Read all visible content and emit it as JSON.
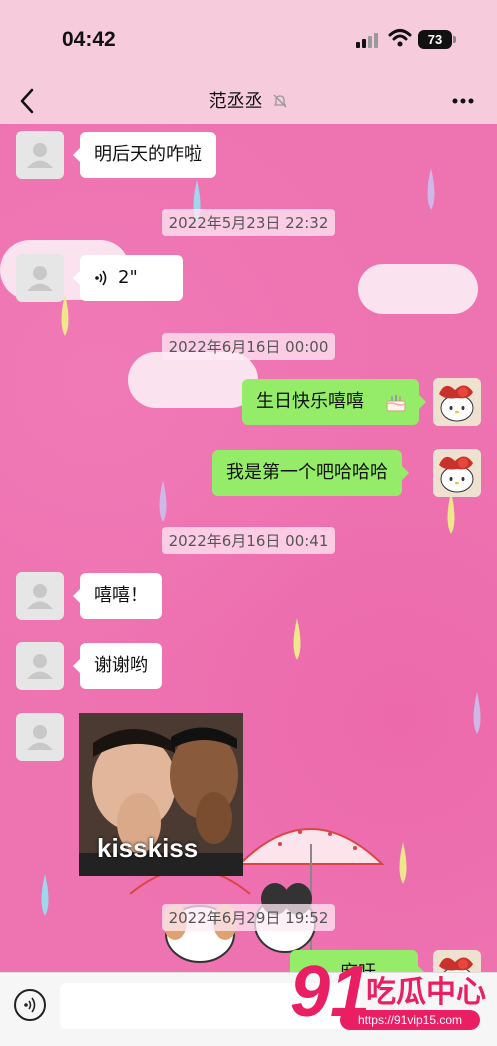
{
  "status": {
    "time": "04:42",
    "battery": "73"
  },
  "header": {
    "title": "范丞丞"
  },
  "messages": {
    "m1": "明后天的咋啦",
    "ts1": "2022年5月23日 22:32",
    "voice_duration": "2\"",
    "ts2": "2022年6月16日 00:00",
    "m2": "生日快乐嘻嘻",
    "m3": "我是第一个吧哈哈哈",
    "ts3": "2022年6月16日 00:41",
    "m4": "嘻嘻！",
    "m5": "谢谢哟",
    "sticker_caption": "kisskiss",
    "ts4": "2022年6月29日 19:52",
    "m6_partial": "麻吁"
  },
  "watermark": {
    "logo_text": "91吃瓜中心",
    "url": "https://91vip15.com"
  },
  "colors": {
    "bubble_out": "#95ec69",
    "bubble_in": "#ffffff",
    "chat_bg": "#ee73b1",
    "status_bg": "#f6cbdc"
  },
  "icons": [
    "back-icon",
    "mute-bell-icon",
    "more-icon",
    "voice-wave-icon",
    "cake-emoji",
    "voice-input-icon",
    "default-avatar-icon",
    "hello-kitty-avatar"
  ]
}
